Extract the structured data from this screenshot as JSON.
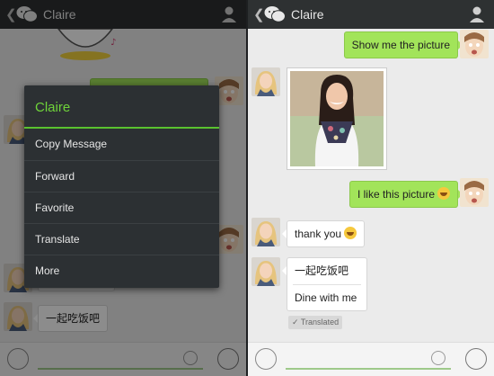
{
  "contact": {
    "name": "Claire"
  },
  "left_panel": {
    "visible_message": "一起吃饭吧",
    "context_menu": {
      "title": "Claire",
      "items": [
        "Copy Message",
        "Forward",
        "Favorite",
        "Translate",
        "More"
      ]
    }
  },
  "right_panel": {
    "messages": [
      {
        "from": "me",
        "text": "Show me the picture"
      },
      {
        "from": "contact",
        "type": "photo"
      },
      {
        "from": "me",
        "text": "I like this picture"
      },
      {
        "from": "contact",
        "text": "thank you"
      },
      {
        "from": "contact",
        "text": "一起吃饭吧",
        "translation": "Dine with me",
        "badge": "Translated"
      }
    ]
  },
  "icons": {
    "back": "chevron-left-icon",
    "logo": "chat-bubbles-icon",
    "profile": "person-icon",
    "voice": "voice-icon",
    "emoji": "smiley-icon",
    "add": "plus-icon"
  },
  "colors": {
    "accent_green": "#6fd33a",
    "sent_bubble": "#a2e45a",
    "titlebar": "#2e3132",
    "menu_bg": "#2c3033"
  }
}
